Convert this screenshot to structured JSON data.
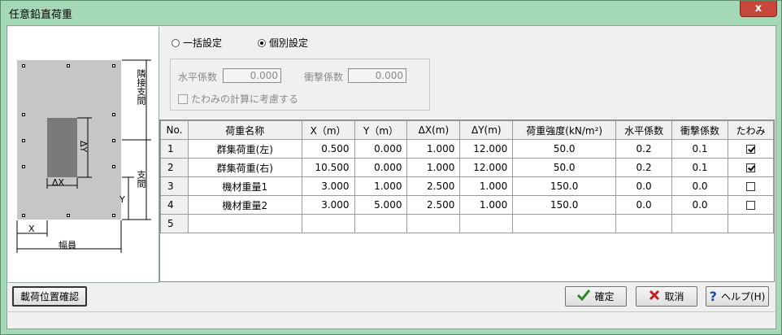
{
  "window": {
    "title": "任意鉛直荷重",
    "close_glyph": "x"
  },
  "diagram": {
    "adjacent_span": "隣接支間",
    "span": "支間",
    "width": "幅員",
    "x": "X",
    "y": "Y",
    "dx": "ΔX",
    "dy": "ΔY"
  },
  "mode": {
    "bulk": "一括設定",
    "individual": "個別設定",
    "selected": "individual"
  },
  "bulk_group": {
    "horizontal_label": "水平係数",
    "horizontal_value": "0.000",
    "impact_label": "衝撃係数",
    "impact_value": "0.000",
    "deflection_label": "たわみの計算に考慮する"
  },
  "table": {
    "headers": [
      "No.",
      "荷重名称",
      "X（m）",
      "Y（m）",
      "ΔX(m)",
      "ΔY(m)",
      "荷重強度(kN/m²)",
      "水平係数",
      "衝撃係数",
      "たわみ"
    ],
    "rows": [
      {
        "no": "1",
        "name": "群集荷重(左)",
        "x": "0.500",
        "y": "0.000",
        "dx": "1.000",
        "dy": "12.000",
        "strength": "50.0",
        "h": "0.2",
        "imp": "0.1",
        "defl": true
      },
      {
        "no": "2",
        "name": "群集荷重(右)",
        "x": "10.500",
        "y": "0.000",
        "dx": "1.000",
        "dy": "12.000",
        "strength": "50.0",
        "h": "0.2",
        "imp": "0.1",
        "defl": true
      },
      {
        "no": "3",
        "name": "機材重量1",
        "x": "3.000",
        "y": "1.000",
        "dx": "2.500",
        "dy": "1.000",
        "strength": "150.0",
        "h": "0.0",
        "imp": "0.0",
        "defl": false
      },
      {
        "no": "4",
        "name": "機材重量2",
        "x": "3.000",
        "y": "5.000",
        "dx": "2.500",
        "dy": "1.000",
        "strength": "150.0",
        "h": "0.0",
        "imp": "0.0",
        "defl": false
      },
      {
        "no": "5",
        "name": "",
        "x": "",
        "y": "",
        "dx": "",
        "dy": "",
        "strength": "",
        "h": "",
        "imp": "",
        "defl": null
      }
    ]
  },
  "buttons": {
    "confirm_position": "載荷位置確認",
    "ok": "確定",
    "cancel": "取消",
    "help": "ヘルプ(H)"
  },
  "colors": {
    "titlebar": "#a5d8b6",
    "ok_icon": "#2a8a2a",
    "cancel_icon": "#c02020",
    "help_icon": "#1a4aa0"
  }
}
